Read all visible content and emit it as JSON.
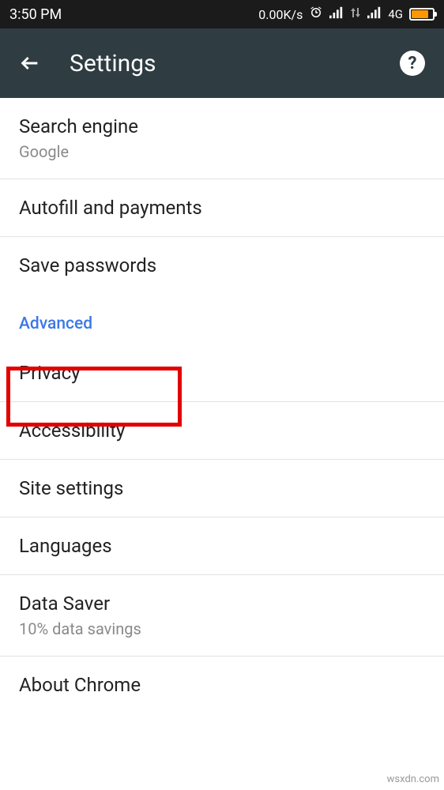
{
  "status": {
    "time": "3:50 PM",
    "speed": "0.00K/s",
    "net_label": "4G"
  },
  "appbar": {
    "title": "Settings",
    "help_label": "?"
  },
  "basics": {
    "search_engine": {
      "title": "Search engine",
      "sub": "Google"
    },
    "autofill": {
      "title": "Autofill and payments"
    },
    "save_passwords": {
      "title": "Save passwords"
    }
  },
  "advanced": {
    "header": "Advanced",
    "privacy": {
      "title": "Privacy"
    },
    "accessibility": {
      "title": "Accessibility"
    },
    "site_settings": {
      "title": "Site settings"
    },
    "languages": {
      "title": "Languages"
    },
    "data_saver": {
      "title": "Data Saver",
      "sub": "10% data savings"
    },
    "about": {
      "title": "About Chrome"
    }
  },
  "watermark": "wsxdn.com"
}
